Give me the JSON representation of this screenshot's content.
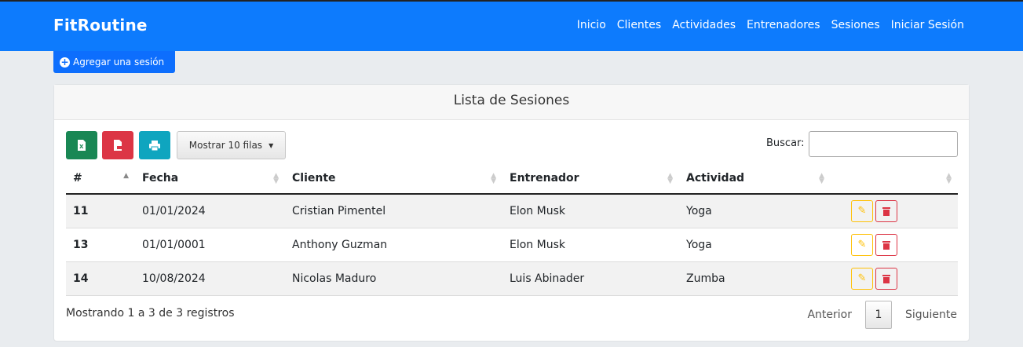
{
  "app": {
    "brand": "FitRoutine"
  },
  "nav": {
    "items": [
      "Inicio",
      "Clientes",
      "Actividades",
      "Entrenadores",
      "Sesiones",
      "Iniciar Sesión"
    ]
  },
  "actions": {
    "add_label": "Agregar una sesión"
  },
  "card": {
    "title": "Lista de Sesiones"
  },
  "toolbar": {
    "rows_label": "Mostrar 10 filas",
    "search_label": "Buscar:",
    "search_value": ""
  },
  "table": {
    "headers": [
      "#",
      "Fecha",
      "Cliente",
      "Entrenador",
      "Actividad",
      ""
    ],
    "rows": [
      [
        "11",
        "01/01/2024",
        "Cristian Pimentel",
        "Elon Musk",
        "Yoga"
      ],
      [
        "13",
        "01/01/0001",
        "Anthony Guzman",
        "Elon Musk",
        "Yoga"
      ],
      [
        "14",
        "10/08/2024",
        "Nicolas Maduro",
        "Luis Abinader",
        "Zumba"
      ]
    ]
  },
  "footer": {
    "info": "Mostrando 1 a 3 de 3 registros",
    "prev": "Anterior",
    "page": "1",
    "next": "Siguiente"
  },
  "colors": {
    "navbar": "#0d7bfd",
    "primary": "#0d6efd",
    "excel": "#198754",
    "pdf": "#dc3545",
    "print": "#0fa5bf",
    "edit": "#ffc107",
    "delete": "#dc3545"
  },
  "icons": {
    "add": "plus-circle-icon",
    "excel": "file-excel-icon",
    "pdf": "file-pdf-icon",
    "print": "print-icon",
    "edit": "pencil-icon",
    "delete": "trash-icon"
  }
}
